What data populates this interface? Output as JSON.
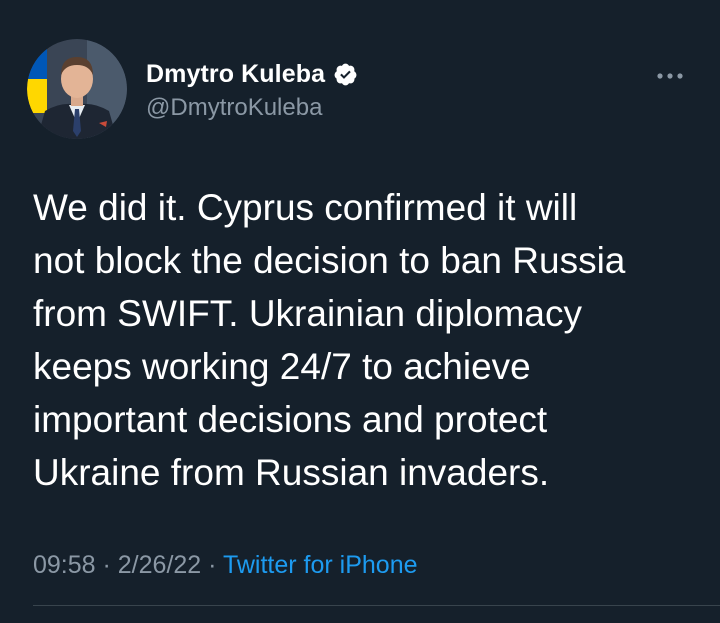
{
  "author": {
    "display_name": "Dmytro Kuleba",
    "handle": "@DmytroKuleba",
    "verified": true,
    "avatar_icon": "profile-photo"
  },
  "tweet": {
    "text": "We did it. Cyprus confirmed it will\nnot block the decision to ban Russia\nfrom SWIFT. Ukrainian diplomacy\nkeeps working 24/7 to achieve\nimportant decisions and protect\nUkraine from Russian invaders."
  },
  "meta": {
    "time": "09:58",
    "sep1": " · ",
    "date": "2/26/22",
    "sep2": " · ",
    "source": "Twitter for iPhone"
  },
  "more_icon": "ellipsis-icon",
  "colors": {
    "background": "#15202b",
    "text_primary": "#ffffff",
    "text_secondary": "#8b98a5",
    "link": "#1d9bf0",
    "divider": "#38444d"
  }
}
